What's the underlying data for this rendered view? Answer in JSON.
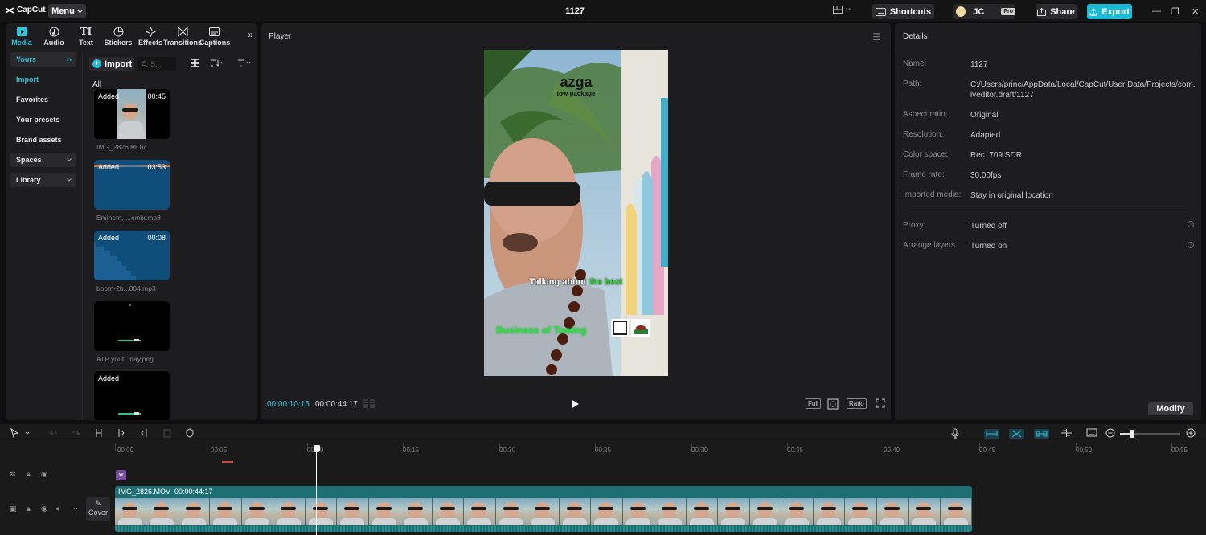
{
  "app": {
    "logo_text": "CapCut",
    "menu_label": "Menu",
    "project_title": "1127",
    "shortcuts_label": "Shortcuts",
    "user_initials": "JC",
    "pro_badge": "Pro",
    "share_label": "Share",
    "export_label": "Export",
    "accent_color": "#16bcd6"
  },
  "tabs": [
    {
      "label": "Media",
      "icon": "media-icon"
    },
    {
      "label": "Audio",
      "icon": "audio-icon"
    },
    {
      "label": "Text",
      "icon": "text-icon"
    },
    {
      "label": "Stickers",
      "icon": "stickers-icon"
    },
    {
      "label": "Effects",
      "icon": "effects-icon"
    },
    {
      "label": "Transitions",
      "icon": "transitions-icon"
    },
    {
      "label": "Captions",
      "icon": "captions-icon"
    }
  ],
  "sidebar": {
    "yours": "Yours",
    "items": [
      "Import",
      "Favorites",
      "Your presets",
      "Brand assets"
    ],
    "spaces": "Spaces",
    "library": "Library"
  },
  "media": {
    "import_label": "Import",
    "search_placeholder": "S...",
    "all_label": "All",
    "items": [
      {
        "name": "IMG_2826.MOV",
        "badge": "Added",
        "duration": "00:45"
      },
      {
        "name": "Eminem, ...emix.mp3",
        "badge": "Added",
        "duration": "03:53"
      },
      {
        "name": "boom-2b...004.mp3",
        "badge": "Added",
        "duration": "00:08"
      },
      {
        "name": "ATP yout...rlay.png",
        "badge": "",
        "duration": ""
      },
      {
        "name": "",
        "badge": "Added",
        "duration": ""
      }
    ]
  },
  "player": {
    "title": "Player",
    "current_time": "00:00:10:15",
    "total_time": "00:00:44:17",
    "full_label": "Full",
    "ratio_label": "Ratio",
    "overlay_logo": "azga",
    "overlay_subtext": "tow package",
    "caption_white": "Talking about ",
    "caption_green": "the best",
    "overlay_business": "Business of Towing"
  },
  "details": {
    "title": "Details",
    "rows": [
      {
        "label": "Name:",
        "value": "1127"
      },
      {
        "label": "Path:",
        "value": "C:/Users/princ/AppData/Local/CapCut/User Data/Projects/com.lveditor.draft/1127"
      },
      {
        "label": "Aspect ratio:",
        "value": "Original"
      },
      {
        "label": "Resolution:",
        "value": "Adapted"
      },
      {
        "label": "Color space:",
        "value": "Rec. 709 SDR"
      },
      {
        "label": "Frame rate:",
        "value": "30.00fps"
      },
      {
        "label": "Imported media:",
        "value": "Stay in original location"
      },
      {
        "label": "Proxy:",
        "value": "Turned off"
      },
      {
        "label": "Arrange layers",
        "value": "Turned on"
      }
    ],
    "modify_label": "Modify"
  },
  "timeline": {
    "ruler": [
      "00:00",
      "00:05",
      "00:10",
      "00:15",
      "00:20",
      "00:25",
      "00:30",
      "00:35",
      "00:40",
      "00:45",
      "00:50",
      "00:55"
    ],
    "clip_name": "IMG_2826.MOV",
    "clip_duration": "00:00:44:17",
    "cover_label": "Cover",
    "zoom_level": 0.2
  }
}
